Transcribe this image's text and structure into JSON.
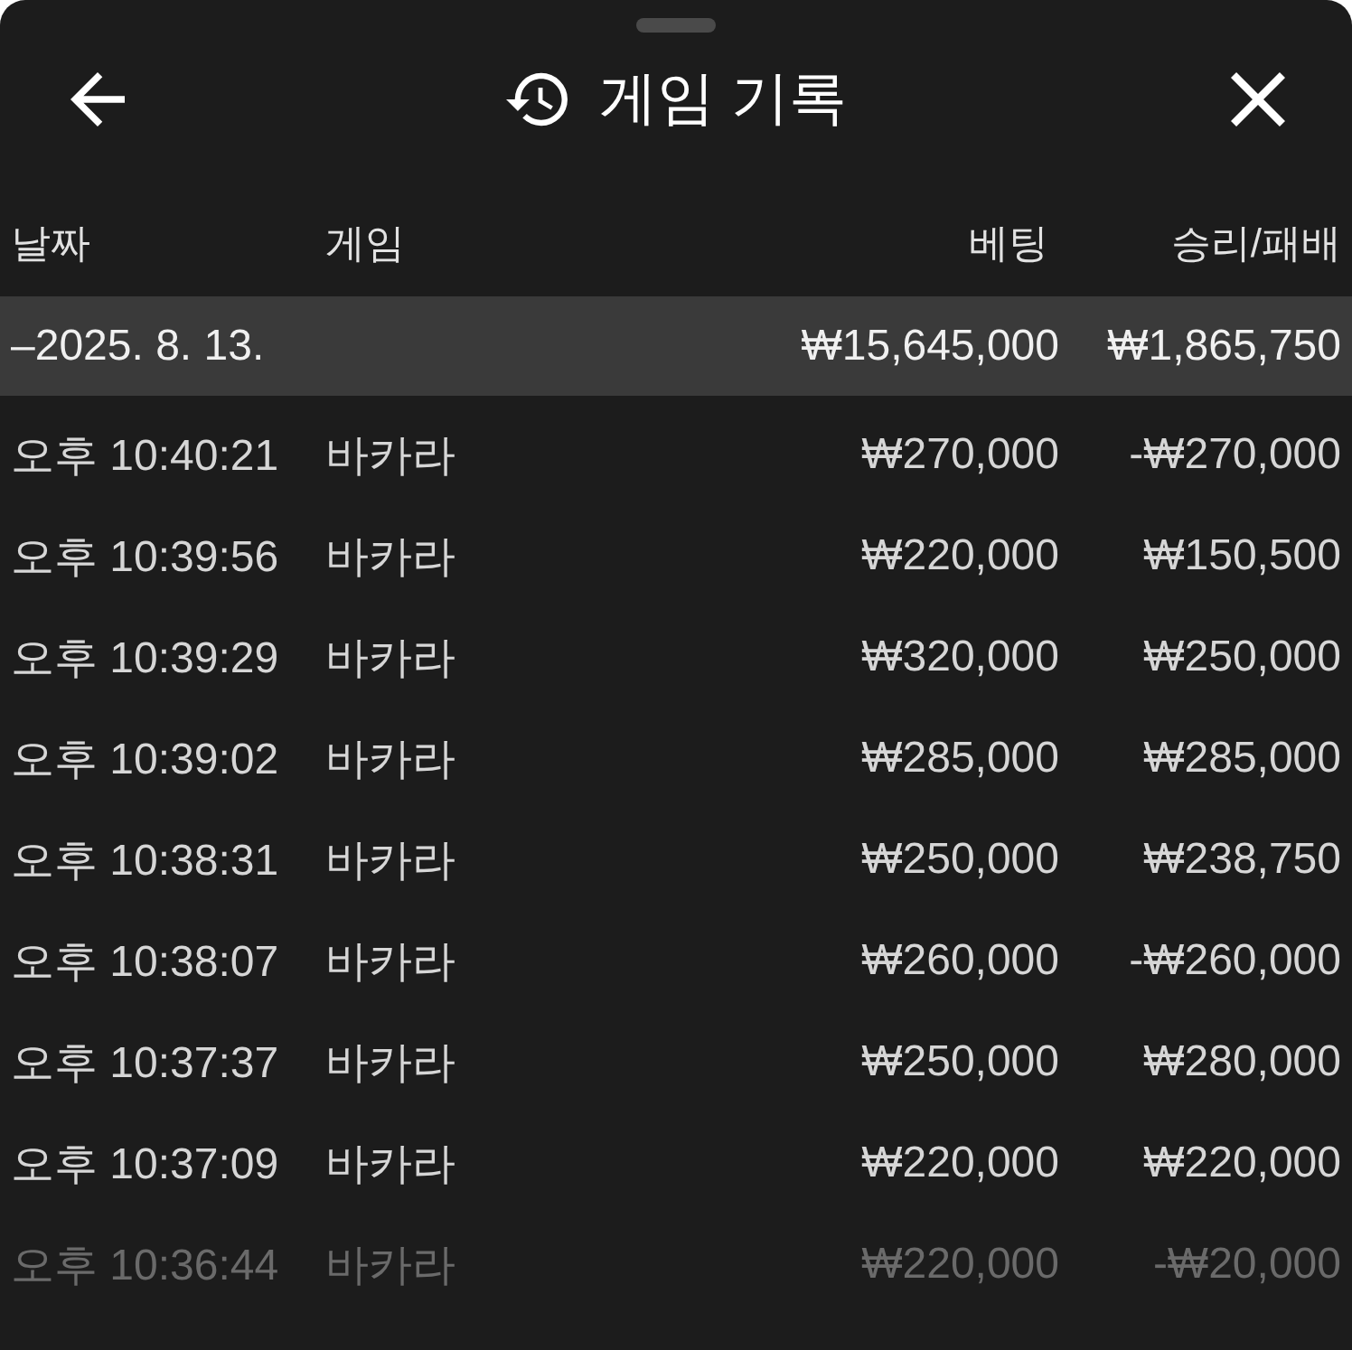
{
  "window": {
    "title": "게임 기록"
  },
  "table": {
    "columns": [
      "날짜",
      "게임",
      "베팅",
      "승리/패배"
    ],
    "group": {
      "date": "–2025. 8. 13.",
      "bet": "₩15,645,000",
      "result": "₩1,865,750"
    },
    "rows": [
      {
        "time": "오후 10:40:21",
        "game": "바카라",
        "bet": "₩270,000",
        "result": "-₩270,000"
      },
      {
        "time": "오후 10:39:56",
        "game": "바카라",
        "bet": "₩220,000",
        "result": "₩150,500"
      },
      {
        "time": "오후 10:39:29",
        "game": "바카라",
        "bet": "₩320,000",
        "result": "₩250,000"
      },
      {
        "time": "오후 10:39:02",
        "game": "바카라",
        "bet": "₩285,000",
        "result": "₩285,000"
      },
      {
        "time": "오후 10:38:31",
        "game": "바카라",
        "bet": "₩250,000",
        "result": "₩238,750"
      },
      {
        "time": "오후 10:38:07",
        "game": "바카라",
        "bet": "₩260,000",
        "result": "-₩260,000"
      },
      {
        "time": "오후 10:37:37",
        "game": "바카라",
        "bet": "₩250,000",
        "result": "₩280,000"
      },
      {
        "time": "오후 10:37:09",
        "game": "바카라",
        "bet": "₩220,000",
        "result": "₩220,000"
      },
      {
        "time": "오후 10:36:44",
        "game": "바카라",
        "bet": "₩220,000",
        "result": "-₩20,000"
      }
    ]
  }
}
